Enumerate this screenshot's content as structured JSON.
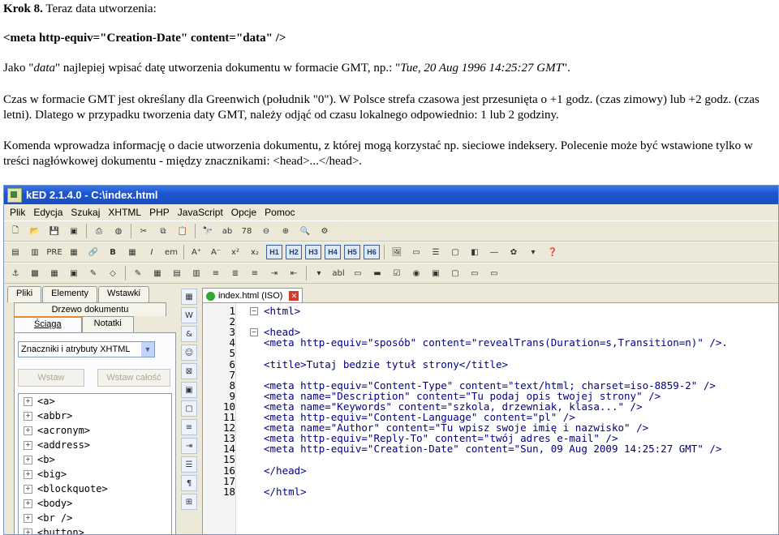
{
  "doc": {
    "step_label": "Krok 8.",
    "step_text": " Teraz data utworzenia:",
    "meta_tag": "<meta http-equiv=\"Creation-Date\" content=\"data\" />",
    "p1_a": "Jako \"",
    "p1_em": "data",
    "p1_b": "\" najlepiej wpisać datę utworzenia dokumentu w formacie GMT, np.: \"",
    "p1_example": "Tue, 20 Aug 1996 14:25:27 GMT",
    "p1_c": "\".",
    "p2": "Czas w formacie GMT jest określany dla Greenwich (południk \"0\"). W Polsce strefa czasowa jest przesunięta o +1 godz. (czas zimowy) lub +2 godz. (czas letni). Dlatego w przypadku tworzenia daty GMT, należy odjąć od czasu lokalnego odpowiednio: 1 lub 2 godziny.",
    "p3": "Komenda wprowadza informację o dacie utworzenia dokumentu, z której mogą korzystać np. sieciowe indeksery. Polecenie może być wstawione tylko w treści nagłówkowej dokumentu - między znacznikami: <head>...</head>."
  },
  "app": {
    "title": "kED 2.1.4.0 - C:\\index.html",
    "menu": [
      "Plik",
      "Edycja",
      "Szukaj",
      "XHTML",
      "PHP",
      "JavaScript",
      "Opcje",
      "Pomoc"
    ],
    "left_tabs": [
      "Pliki",
      "Elementy",
      "Wstawki"
    ],
    "tree_tab": "Drzewo dokumentu",
    "sub_tabs": [
      "Ściąga",
      "Notatki"
    ],
    "select_value": "Znaczniki i atrybuty XHTML",
    "insert_button": "Wstaw",
    "insert_all_button": "Wstaw całość",
    "tags": [
      "<a>",
      "<abbr>",
      "<acronym>",
      "<address>",
      "<b>",
      "<big>",
      "<blockquote>",
      "<body>",
      "<br />",
      "<button>"
    ],
    "editor_tab": "index.html (ISO)",
    "code_lines": [
      {
        "n": "1",
        "text": "<html>"
      },
      {
        "n": "2",
        "text": ""
      },
      {
        "n": "3",
        "text": "<head>"
      },
      {
        "n": "4",
        "text": "<meta http-equiv=\"sposób\" content=\"revealTrans(Duration=s,Transition=n)\" />."
      },
      {
        "n": "5",
        "text": ""
      },
      {
        "n": "6",
        "text": "<title>Tutaj bedzie tytuł strony</title>"
      },
      {
        "n": "7",
        "text": ""
      },
      {
        "n": "8",
        "text": "<meta http-equiv=\"Content-Type\" content=\"text/html; charset=iso-8859-2\" />"
      },
      {
        "n": "9",
        "text": "<meta name=\"Description\" content=\"Tu podaj opis twojej strony\" />"
      },
      {
        "n": "10",
        "text": "<meta name=\"Keywords\" content=\"szkola, drzewniak, klasa...\" />"
      },
      {
        "n": "11",
        "text": "<meta http-equiv=\"Content-Language\" content=\"pl\" />"
      },
      {
        "n": "12",
        "text": "<meta name=\"Author\" content=\"Tu wpisz swoje imię i nazwisko\" />"
      },
      {
        "n": "13",
        "text": "<meta http-equiv=\"Reply-To\" content=\"twój adres e-mail\" />"
      },
      {
        "n": "14",
        "text": "<meta http-equiv=\"Creation-Date\" content=\"Sun, 09 Aug 2009 14:25:27 GMT\" />"
      },
      {
        "n": "15",
        "text": ""
      },
      {
        "n": "16",
        "text": "</head>"
      },
      {
        "n": "17",
        "text": ""
      },
      {
        "n": "18",
        "text": "</html>"
      }
    ]
  }
}
